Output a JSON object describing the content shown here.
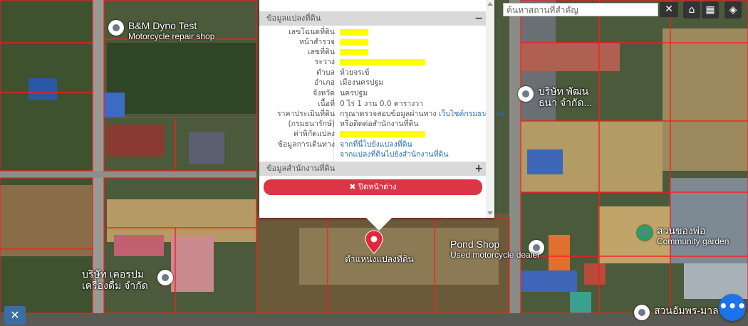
{
  "map": {
    "places": [
      {
        "name": "B&M Dyno Test",
        "sub": "Motorcycle repair shop"
      },
      {
        "name": "บริษัท พัฒน",
        "sub": "ธนา จำกัด..."
      },
      {
        "name": "Pond Shop",
        "sub": "Used motorcycle dealer"
      },
      {
        "name": "สวนของพ่อ",
        "sub": "Community garden"
      },
      {
        "name": "บริษัท เคอรปม",
        "sub": "เครื่องดื่ม จำกัด"
      },
      {
        "name": "สวนอัมพร-มาล",
        "sub": ""
      }
    ],
    "marker_label": "ตำแหน่งแปลงที่ดิน"
  },
  "search": {
    "placeholder": "ค้นหาสถานที่สำคัญ",
    "clear_icon": "✕"
  },
  "toolbar": {
    "home_icon": "⌂",
    "grid_icon": "▦",
    "layers_icon": "◈"
  },
  "panel": {
    "section1_title": "ข้อมูลแปลงที่ดิน",
    "section1_sign": "−",
    "rows": [
      {
        "label": "เลขโฉนดที่ดิน",
        "value": "",
        "highlight": 40
      },
      {
        "label": "หน้าสำรวจ",
        "value": "",
        "highlight": 40
      },
      {
        "label": "เลขที่ดิน",
        "value": "",
        "highlight": 40
      },
      {
        "label": "ระวาง",
        "value": "",
        "highlight": 120
      },
      {
        "label": "ตำบล",
        "value": "ห้วยจรเข้"
      },
      {
        "label": "อำเภอ",
        "value": "เมืองนครปฐม"
      },
      {
        "label": "จังหวัด",
        "value": "นครปฐม"
      },
      {
        "label": "เนื้อที่",
        "value": "0 ไร่ 1 งาน 0.0 ตารางวา"
      },
      {
        "label": "ราคาประเมินที่ดิน",
        "value": "กรุณาตรวจสอบข้อมูลผ่านทาง",
        "link": "เว็บไซต์กรมธนารักษ์"
      },
      {
        "label": "(กรมธนารักษ์)",
        "value": "หรือติดต่อสำนักงานที่ดิน"
      },
      {
        "label": "ค่าพิกัดแปลง",
        "value": "",
        "highlight": 120
      },
      {
        "label": "ข้อมูลการเดินทาง",
        "value": "",
        "link": "จากที่นี่ไปยังแปลงที่ดิน"
      },
      {
        "label": "",
        "value": "",
        "link": "จากแปลงที่ดินไปยังสำนักงานที่ดิน"
      }
    ],
    "section2_title": "ข้อมูลสำนักงานที่ดิน",
    "section2_sign": "+",
    "close_label": "✖ ปิดหน้าต่าง"
  },
  "tool_icon": "✕",
  "more_icon": "•••",
  "colors": {
    "parcel": "#ff1a1a",
    "highlight": "#ffff00",
    "close": "#dc3545",
    "link": "#2a6fb9",
    "more": "#1a73e8"
  }
}
